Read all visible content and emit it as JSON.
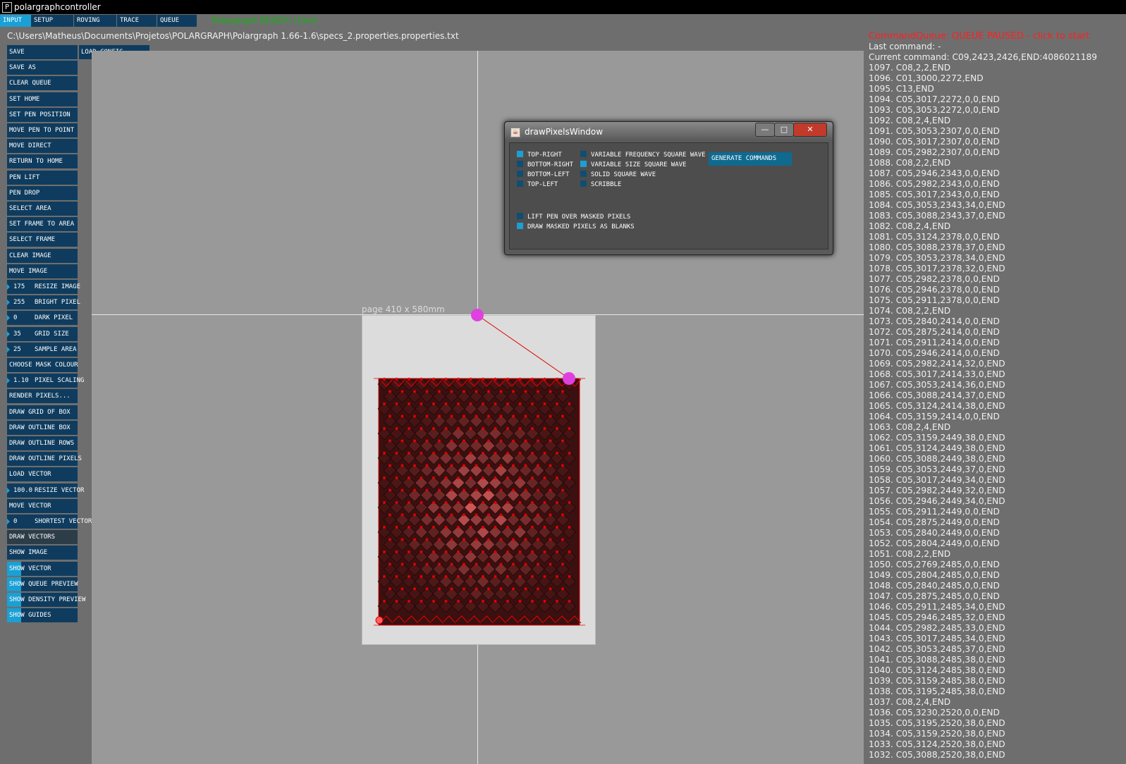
{
  "window": {
    "title": "polargraphcontroller"
  },
  "tabs": [
    {
      "label": "INPUT",
      "active": true
    },
    {
      "label": "SETUP",
      "active": false
    },
    {
      "label": "ROVING",
      "active": false
    },
    {
      "label": "TRACE",
      "active": false
    },
    {
      "label": "QUEUE",
      "active": false
    }
  ],
  "status_text": "Polargraph READY! (Uno)",
  "file_path": "C:\\Users\\Matheus\\Documents\\Projetos\\POLARGRAPH\\Polargraph 1.66-1.6\\specs_2.properties.properties.txt",
  "load_config_label": "LOAD CONFIG",
  "buttons": [
    {
      "label": "SAVE"
    },
    {
      "label": "SAVE AS"
    },
    {
      "label": "CLEAR QUEUE"
    },
    {
      "label": "SET HOME"
    },
    {
      "label": "SET PEN POSITION"
    },
    {
      "label": "MOVE PEN TO POINT"
    },
    {
      "label": "MOVE DIRECT"
    },
    {
      "label": "RETURN TO HOME"
    },
    {
      "label": "PEN LIFT"
    },
    {
      "label": "PEN DROP"
    },
    {
      "label": "SELECT AREA"
    },
    {
      "label": "SET FRAME TO AREA"
    },
    {
      "label": "SELECT FRAME"
    },
    {
      "label": "CLEAR IMAGE"
    },
    {
      "label": "MOVE IMAGE"
    },
    {
      "label": "RESIZE IMAGE",
      "value": "175"
    },
    {
      "label": "BRIGHT PIXEL",
      "value": "255"
    },
    {
      "label": "DARK PIXEL",
      "value": "0"
    },
    {
      "label": "GRID SIZE",
      "value": "35"
    },
    {
      "label": "SAMPLE AREA",
      "value": "25"
    },
    {
      "label": "CHOOSE MASK COLOUR"
    },
    {
      "label": "PIXEL SCALING",
      "value": "1.10"
    },
    {
      "label": "RENDER PIXELS..."
    },
    {
      "label": "DRAW GRID OF BOX"
    },
    {
      "label": "DRAW OUTLINE BOX"
    },
    {
      "label": "DRAW OUTLINE ROWS"
    },
    {
      "label": "DRAW OUTLINE PIXELS"
    },
    {
      "label": "LOAD VECTOR"
    },
    {
      "label": "RESIZE VECTOR",
      "value": "100.0"
    },
    {
      "label": "MOVE VECTOR"
    },
    {
      "label": "SHORTEST VECTOR",
      "value": "0"
    },
    {
      "label": "DRAW VECTORS",
      "dim": true
    },
    {
      "label": "SHOW IMAGE",
      "toggle": true,
      "on": false
    },
    {
      "label": "SHOW VECTOR",
      "toggle": true,
      "on": true
    },
    {
      "label": "SHOW QUEUE PREVIEW",
      "toggle": true,
      "on": true
    },
    {
      "label": "SHOW DENSITY PREVIEW",
      "toggle": true,
      "on": true
    },
    {
      "label": "SHOW GUIDES",
      "toggle": true,
      "on": true
    }
  ],
  "page_label": "page 410 x 580mm",
  "queue": {
    "title": "CommandQueue: QUEUE PAUSED - click to start",
    "last_command": "Last command: -",
    "current_command": "Current command: C09,2423,2426,END:4086021189",
    "entries": [
      "1097. C08,2,2,END",
      "1096. C01,3000,2272,END",
      "1095. C13,END",
      "1094. C05,3017,2272,0,0,END",
      "1093. C05,3053,2272,0,0,END",
      "1092. C08,2,4,END",
      "1091. C05,3053,2307,0,0,END",
      "1090. C05,3017,2307,0,0,END",
      "1089. C05,2982,2307,0,0,END",
      "1088. C08,2,2,END",
      "1087. C05,2946,2343,0,0,END",
      "1086. C05,2982,2343,0,0,END",
      "1085. C05,3017,2343,0,0,END",
      "1084. C05,3053,2343,34,0,END",
      "1083. C05,3088,2343,37,0,END",
      "1082. C08,2,4,END",
      "1081. C05,3124,2378,0,0,END",
      "1080. C05,3088,2378,37,0,END",
      "1079. C05,3053,2378,34,0,END",
      "1078. C05,3017,2378,32,0,END",
      "1077. C05,2982,2378,0,0,END",
      "1076. C05,2946,2378,0,0,END",
      "1075. C05,2911,2378,0,0,END",
      "1074. C08,2,2,END",
      "1073. C05,2840,2414,0,0,END",
      "1072. C05,2875,2414,0,0,END",
      "1071. C05,2911,2414,0,0,END",
      "1070. C05,2946,2414,0,0,END",
      "1069. C05,2982,2414,32,0,END",
      "1068. C05,3017,2414,33,0,END",
      "1067. C05,3053,2414,36,0,END",
      "1066. C05,3088,2414,37,0,END",
      "1065. C05,3124,2414,38,0,END",
      "1064. C05,3159,2414,0,0,END",
      "1063. C08,2,4,END",
      "1062. C05,3159,2449,38,0,END",
      "1061. C05,3124,2449,38,0,END",
      "1060. C05,3088,2449,38,0,END",
      "1059. C05,3053,2449,37,0,END",
      "1058. C05,3017,2449,34,0,END",
      "1057. C05,2982,2449,32,0,END",
      "1056. C05,2946,2449,34,0,END",
      "1055. C05,2911,2449,0,0,END",
      "1054. C05,2875,2449,0,0,END",
      "1053. C05,2840,2449,0,0,END",
      "1052. C05,2804,2449,0,0,END",
      "1051. C08,2,2,END",
      "1050. C05,2769,2485,0,0,END",
      "1049. C05,2804,2485,0,0,END",
      "1048. C05,2840,2485,0,0,END",
      "1047. C05,2875,2485,0,0,END",
      "1046. C05,2911,2485,34,0,END",
      "1045. C05,2946,2485,32,0,END",
      "1044. C05,2982,2485,33,0,END",
      "1043. C05,3017,2485,34,0,END",
      "1042. C05,3053,2485,37,0,END",
      "1041. C05,3088,2485,38,0,END",
      "1040. C05,3124,2485,38,0,END",
      "1039. C05,3159,2485,38,0,END",
      "1038. C05,3195,2485,38,0,END",
      "1037. C08,2,4,END",
      "1036. C05,3230,2520,0,0,END",
      "1035. C05,3195,2520,38,0,END",
      "1034. C05,3159,2520,38,0,END",
      "1033. C05,3124,2520,38,0,END",
      "1032. C05,3088,2520,38,0,END"
    ]
  },
  "dialog": {
    "title": "drawPixelsWindow",
    "start_corner_options": [
      {
        "label": "TOP-RIGHT",
        "on": true
      },
      {
        "label": "BOTTOM-RIGHT",
        "on": false
      },
      {
        "label": "BOTTOM-LEFT",
        "on": false
      },
      {
        "label": "TOP-LEFT",
        "on": false
      }
    ],
    "style_options": [
      {
        "label": "VARIABLE FREQUENCY SQUARE WAVE",
        "on": false
      },
      {
        "label": "VARIABLE SIZE SQUARE WAVE",
        "on": true
      },
      {
        "label": "SOLID SQUARE WAVE",
        "on": false
      },
      {
        "label": "SCRIBBLE",
        "on": false
      }
    ],
    "generate_label": "GENERATE COMMANDS",
    "mask_options": [
      {
        "label": "LIFT PEN OVER MASKED PIXELS",
        "on": false
      },
      {
        "label": "DRAW MASKED PIXELS AS BLANKS",
        "on": true
      }
    ]
  },
  "colors": {
    "button_bg": "#0f3c5e",
    "accent": "#1aa0d4",
    "status_green": "#12b312",
    "queue_red": "#ff2020",
    "pen_magenta": "#e040e0",
    "plot_red": "#e00000"
  }
}
